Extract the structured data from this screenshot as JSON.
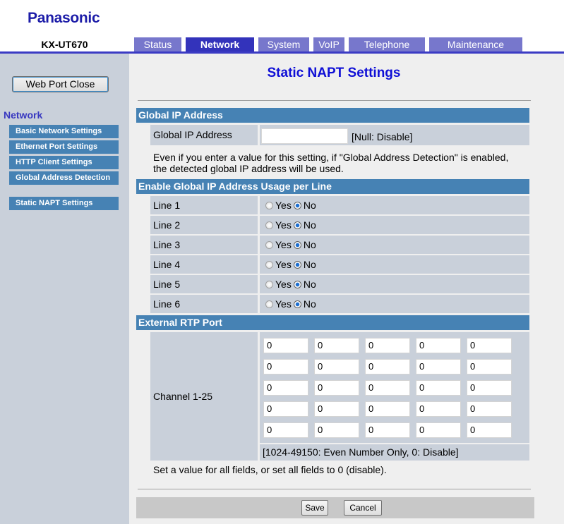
{
  "brand": "Panasonic",
  "model": "KX-UT670",
  "tabs": [
    {
      "label": "Status",
      "active": false
    },
    {
      "label": "Network",
      "active": true
    },
    {
      "label": "System",
      "active": false
    },
    {
      "label": "VoIP",
      "active": false
    },
    {
      "label": "Telephone",
      "active": false
    },
    {
      "label": "Maintenance",
      "active": false
    }
  ],
  "sidebar": {
    "web_port_close_label": "Web Port Close",
    "section_title": "Network",
    "items": [
      {
        "label": "Basic Network Settings"
      },
      {
        "label": "Ethernet Port Settings"
      },
      {
        "label": "HTTP Client Settings"
      },
      {
        "label": "Global Address Detection"
      },
      {
        "label": "Static NAPT Settings"
      }
    ]
  },
  "page_title": "Static NAPT Settings",
  "global_ip": {
    "section_title": "Global IP Address",
    "label": "Global IP Address",
    "value": "",
    "hint": "[Null: Disable]",
    "note_line1": "Even if you enter a value for this setting, if \"Global Address Detection\" is enabled,",
    "note_line2": "the detected global IP address will be used."
  },
  "usage_per_line": {
    "section_title": "Enable Global IP Address Usage per Line",
    "yes_label": "Yes",
    "no_label": "No",
    "lines": [
      {
        "label": "Line 1",
        "value": "No"
      },
      {
        "label": "Line 2",
        "value": "No"
      },
      {
        "label": "Line 3",
        "value": "No"
      },
      {
        "label": "Line 4",
        "value": "No"
      },
      {
        "label": "Line 5",
        "value": "No"
      },
      {
        "label": "Line 6",
        "value": "No"
      }
    ]
  },
  "rtp": {
    "section_title": "External RTP Port",
    "label": "Channel 1-25",
    "ports": [
      [
        "0",
        "0",
        "0",
        "0",
        "0"
      ],
      [
        "0",
        "0",
        "0",
        "0",
        "0"
      ],
      [
        "0",
        "0",
        "0",
        "0",
        "0"
      ],
      [
        "0",
        "0",
        "0",
        "0",
        "0"
      ],
      [
        "0",
        "0",
        "0",
        "0",
        "0"
      ]
    ],
    "hint": "[1024-49150: Even Number Only, 0: Disable]",
    "note": "Set a value for all fields, or set all fields to 0 (disable)."
  },
  "buttons": {
    "save": "Save",
    "cancel": "Cancel"
  }
}
